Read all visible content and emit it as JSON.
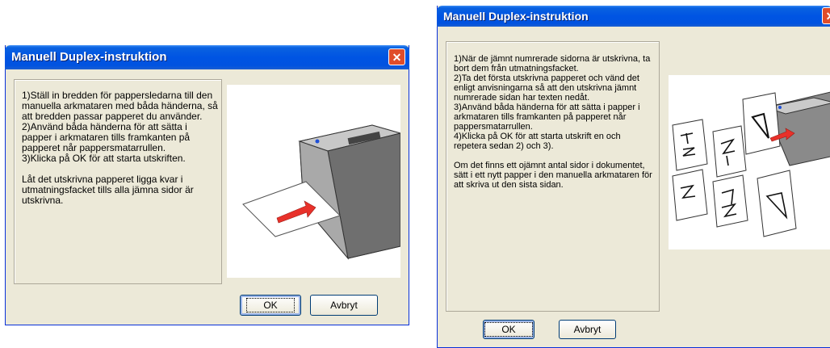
{
  "dialog1": {
    "title": "Manuell Duplex-instruktion",
    "close_label": "✕",
    "instructions": "1)Ställ in bredden för pappersledarna till den manuella arkmataren med båda händerna, så att bredden passar papperet du använder.\n2)Använd båda händerna för att sätta i papper i arkmataren tills framkanten på papperet når pappersmatarrullen.\n3)Klicka på OK för att starta utskriften.\n\nLåt det utskrivna papperet ligga kvar i utmatningsfacket tills alla jämna sidor är utskrivna.",
    "ok_label": "OK",
    "cancel_label": "Avbryt"
  },
  "dialog2": {
    "title": "Manuell Duplex-instruktion",
    "close_label": "✕",
    "instructions": "1)När de jämnt numrerade sidorna är utskrivna, ta bort dem från utmatningsfacket.\n2)Ta det första utskrivna papperet och vänd det enligt anvisningarna så att den utskrivna jämnt numrerade sidan har texten nedåt.\n3)Använd båda händerna för att sätta i papper i arkmataren tills framkanten på papperet når pappersmatarrullen.\n4)Klicka på OK för att starta utskrift en och repetera sedan 2) och 3).\n\n Om det finns ett ojämnt antal sidor i dokumentet, sätt i ett nytt papper i den manuella arkmataren för att skriva ut den sista sidan.",
    "ok_label": "OK",
    "cancel_label": "Avbryt"
  },
  "colors": {
    "titlebar": "#0054e3",
    "dialog_bg": "#ece9d8",
    "close_button": "#e04d2a",
    "feed_arrow": "#e8312a"
  }
}
